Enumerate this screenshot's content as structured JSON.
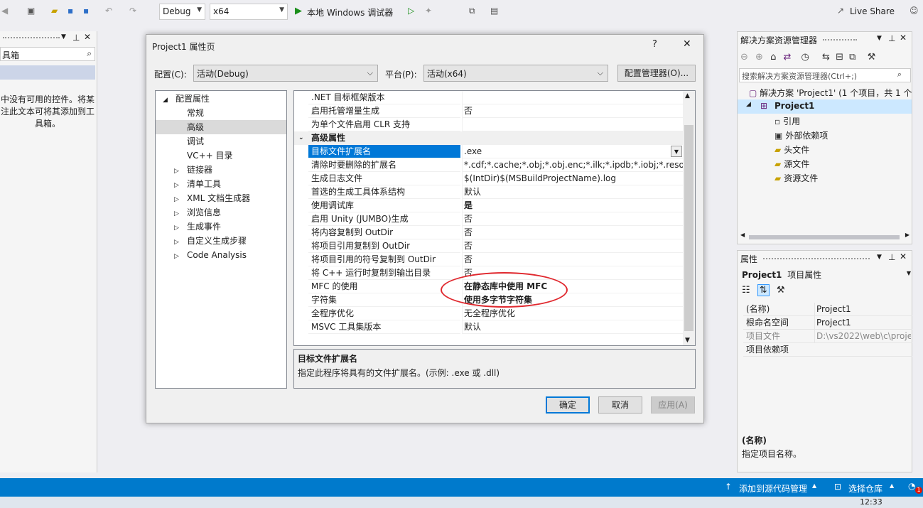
{
  "toolbar": {
    "config": "Debug",
    "platform": "x64",
    "run_label": "本地 Windows 调试器",
    "live_share": "Live Share"
  },
  "toolbox": {
    "title_partial": "具箱",
    "empty_text": "中没有可用的控件。将某\n注此文本可将其添加到工\n具箱。"
  },
  "dialog": {
    "title": "Project1 属性页",
    "help": "?",
    "close": "✕",
    "config_label": "配置(C):",
    "config_value": "活动(Debug)",
    "platform_label": "平台(P):",
    "platform_value": "活动(x64)",
    "config_manager": "配置管理器(O)...",
    "tree": [
      {
        "label": "配置属性",
        "indent": 0,
        "expander": "◢"
      },
      {
        "label": "常规",
        "indent": 1,
        "expander": ""
      },
      {
        "label": "高级",
        "indent": 1,
        "expander": "",
        "selected": true
      },
      {
        "label": "调试",
        "indent": 1,
        "expander": ""
      },
      {
        "label": "VC++ 目录",
        "indent": 1,
        "expander": ""
      },
      {
        "label": "链接器",
        "indent": 1,
        "expander": "▷"
      },
      {
        "label": "清单工具",
        "indent": 1,
        "expander": "▷"
      },
      {
        "label": "XML 文档生成器",
        "indent": 1,
        "expander": "▷"
      },
      {
        "label": "浏览信息",
        "indent": 1,
        "expander": "▷"
      },
      {
        "label": "生成事件",
        "indent": 1,
        "expander": "▷"
      },
      {
        "label": "自定义生成步骤",
        "indent": 1,
        "expander": "▷"
      },
      {
        "label": "Code Analysis",
        "indent": 1,
        "expander": "▷"
      }
    ],
    "props": [
      {
        "name": ".NET 目标框架版本",
        "value": ""
      },
      {
        "name": "启用托管增量生成",
        "value": "否"
      },
      {
        "name": "为单个文件启用 CLR 支持",
        "value": ""
      },
      {
        "name": "高级属性",
        "value": "",
        "category": true
      },
      {
        "name": "目标文件扩展名",
        "value": ".exe",
        "selected": true
      },
      {
        "name": "清除时要删除的扩展名",
        "value": "*.cdf;*.cache;*.obj;*.obj.enc;*.ilk;*.ipdb;*.iobj;*.resources"
      },
      {
        "name": "生成日志文件",
        "value": "$(IntDir)$(MSBuildProjectName).log"
      },
      {
        "name": "首选的生成工具体系结构",
        "value": "默认"
      },
      {
        "name": "使用调试库",
        "value": "是",
        "bold": true
      },
      {
        "name": "启用 Unity (JUMBO)生成",
        "value": "否"
      },
      {
        "name": "将内容复制到 OutDir",
        "value": "否"
      },
      {
        "name": "将项目引用复制到 OutDir",
        "value": "否"
      },
      {
        "name": "将项目引用的符号复制到 OutDir",
        "value": "否"
      },
      {
        "name": "将 C++ 运行时复制到输出目录",
        "value": "否"
      },
      {
        "name": "MFC 的使用",
        "value": "在静态库中使用 MFC",
        "bold": true
      },
      {
        "name": "字符集",
        "value": "使用多字节字符集",
        "bold": true
      },
      {
        "name": "全程序优化",
        "value": "无全程序优化"
      },
      {
        "name": "MSVC 工具集版本",
        "value": "默认"
      }
    ],
    "desc_title": "目标文件扩展名",
    "desc_text": "指定此程序将具有的文件扩展名。(示例: .exe 或 .dll)",
    "ok": "确定",
    "cancel": "取消",
    "apply": "应用(A)"
  },
  "solution": {
    "title": "解决方案资源管理器",
    "search_placeholder": "搜索解决方案资源管理器(Ctrl+;)",
    "root": "解决方案 'Project1' (1 个项目，共 1 个",
    "project": "Project1",
    "items": [
      "引用",
      "外部依赖项",
      "头文件",
      "源文件",
      "资源文件"
    ]
  },
  "properties": {
    "title": "属性",
    "object": "Project1",
    "object_type": "项目属性",
    "rows": [
      {
        "name": "(名称)",
        "value": "Project1"
      },
      {
        "name": "根命名空间",
        "value": "Project1"
      },
      {
        "name": "项目文件",
        "value": "D:\\vs2022\\web\\c\\proje",
        "dim": true
      },
      {
        "name": "项目依赖项",
        "value": ""
      }
    ],
    "desc_title": "(名称)",
    "desc_text": "指定项目名称。"
  },
  "statusbar": {
    "add_source": "添加到源代码管理",
    "select_repo": "选择仓库",
    "notif": "1"
  },
  "taskbar": {
    "time": "12:33"
  },
  "colors": {
    "accent": "#0078d7",
    "statusbar": "#007acc",
    "annotation": "#e0282e"
  }
}
